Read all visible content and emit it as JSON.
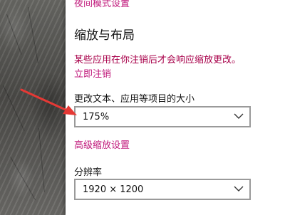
{
  "settings": {
    "night_mode_link": "夜间模式设置",
    "scale_layout_title": "缩放与布局",
    "restart_notice": "某些应用在你注销后才会响应缩放更改。",
    "sign_out_link": "立即注销",
    "scale_label": "更改文本、应用等项目的大小",
    "scale_value": "175%",
    "advanced_scaling_link": "高级缩放设置",
    "resolution_label": "分辨率",
    "resolution_value": "1920 × 1200"
  },
  "colors": {
    "link": "#c0197b",
    "notice": "#a8004a",
    "annotation_arrow": "#e53935"
  },
  "icons": {
    "dropdown": "chevron-down-icon",
    "annotation": "red-arrow-annotation"
  }
}
